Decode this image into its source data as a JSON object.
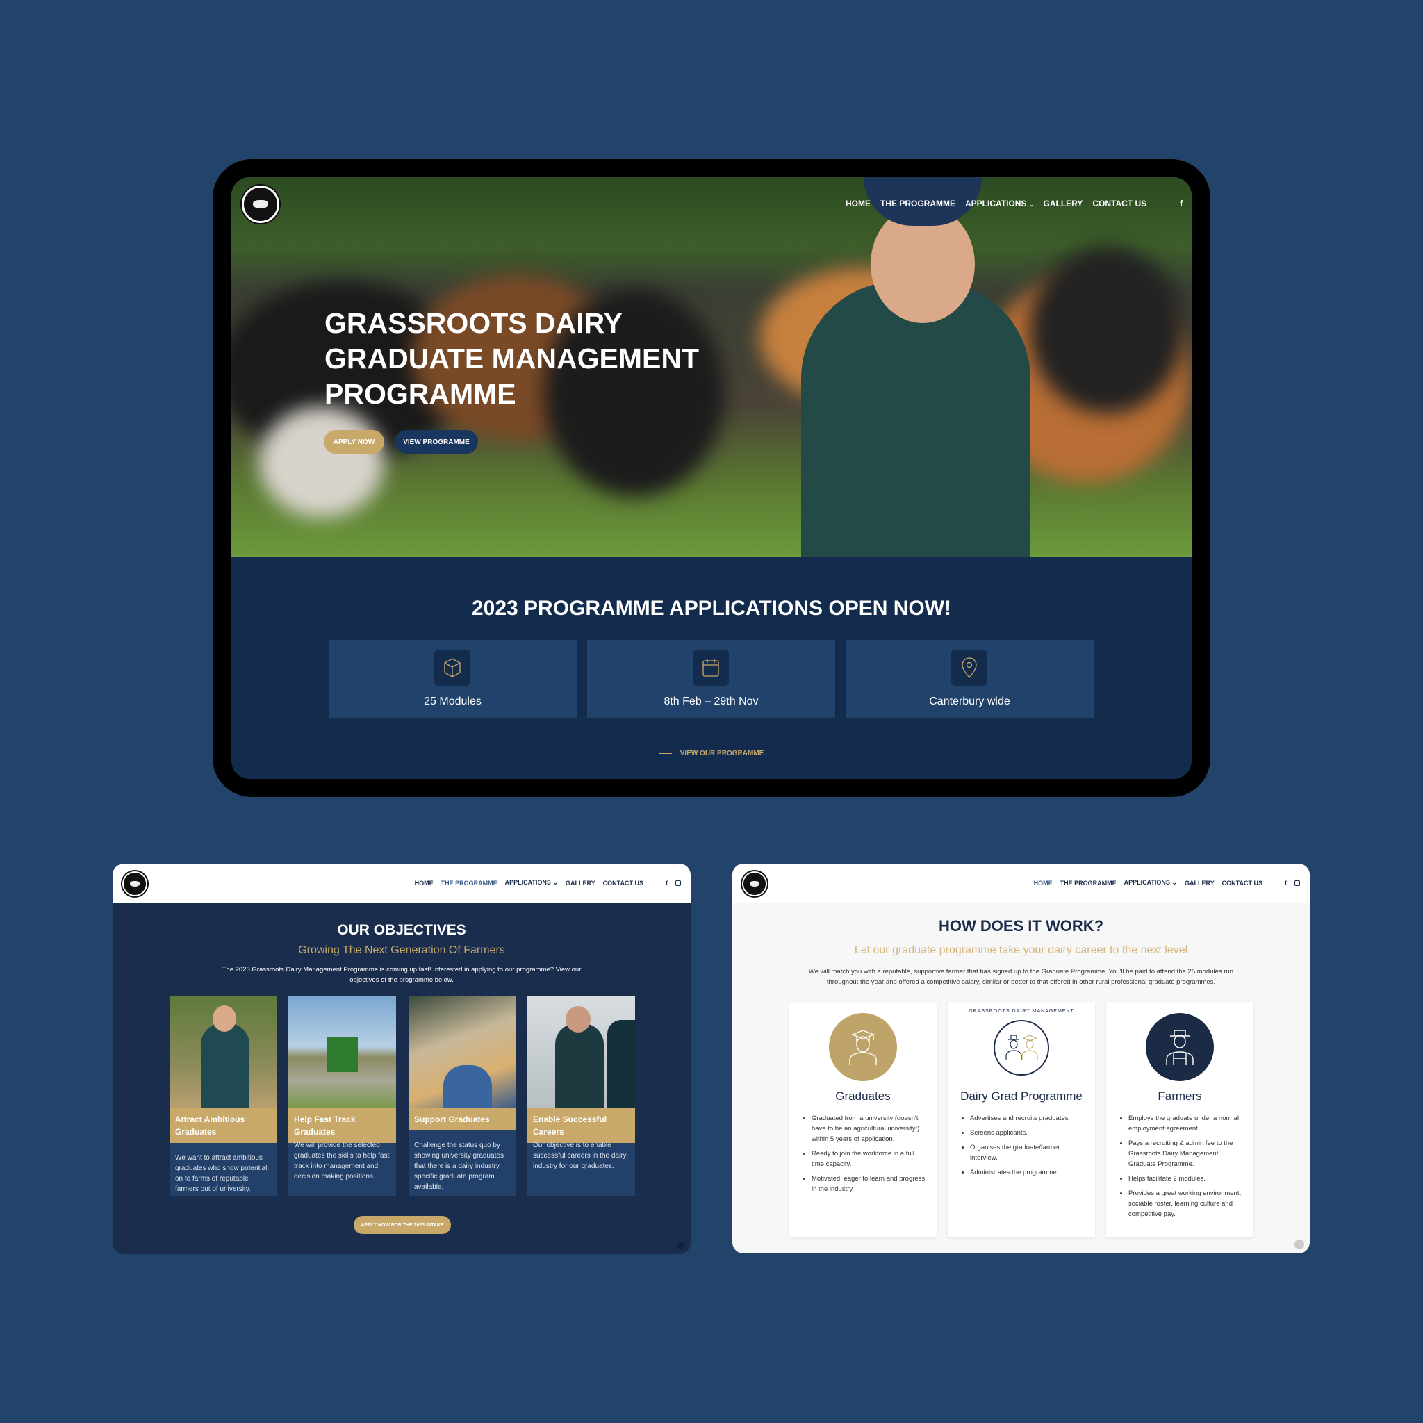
{
  "colors": {
    "background": "#22446b",
    "navy": "#132c4d",
    "card_blue": "#21426b",
    "gold": "#c9a96a"
  },
  "brand": {
    "logo_text": "GRASSROOTS DAIRY MANAGEMENT"
  },
  "hero_page": {
    "nav": [
      {
        "label": "HOME"
      },
      {
        "label": "THE PROGRAMME"
      },
      {
        "label": "APPLICATIONS",
        "has_dropdown": true
      },
      {
        "label": "GALLERY"
      },
      {
        "label": "CONTACT US"
      }
    ],
    "social": [
      {
        "icon": "facebook-icon",
        "glyph": "f"
      },
      {
        "icon": "instagram-icon"
      }
    ],
    "title_lines": [
      "GRASSROOTS DAIRY",
      "GRADUATE MANAGEMENT",
      "PROGRAMME"
    ],
    "apply_button": "APPLY NOW",
    "view_button": "VIEW PROGRAMME",
    "section_heading": "2023 PROGRAMME APPLICATIONS OPEN NOW!",
    "stats": [
      {
        "icon": "cube-icon",
        "label": "25 Modules"
      },
      {
        "icon": "calendar-icon",
        "label": "8th Feb – 29th Nov"
      },
      {
        "icon": "location-pin-icon",
        "label": "Canterbury wide"
      }
    ],
    "view_link": "VIEW OUR PROGRAMME"
  },
  "objectives_page": {
    "nav": [
      {
        "label": "HOME"
      },
      {
        "label": "THE PROGRAMME",
        "active": true
      },
      {
        "label": "APPLICATIONS",
        "has_dropdown": true
      },
      {
        "label": "GALLERY"
      },
      {
        "label": "CONTACT US"
      }
    ],
    "title": "OUR OBJECTIVES",
    "subtitle": "Growing The Next Generation Of Farmers",
    "description": "The 2023 Grassroots Dairy Management Programme is coming up fast! Interested in applying to our programme? View our objectives of the programme below.",
    "cards": [
      {
        "title": "Attract Ambitious Graduates",
        "text": "We want to attract ambitious graduates who show potential, on to farms of reputable farmers out of university."
      },
      {
        "title": "Help Fast Track Graduates",
        "text": "We will provide the selected graduates the skills to help fast track into management and decision making positions."
      },
      {
        "title": "Support Graduates",
        "text": "Challenge the status quo by showing university graduates that there is a dairy industry specific graduate program available."
      },
      {
        "title": "Enable Successful Careers",
        "text": "Our objective is to enable successful careers in the dairy industry for our graduates."
      }
    ],
    "cta": "APPLY NOW FOR THE 2023 INTAKE"
  },
  "how_page": {
    "nav": [
      {
        "label": "HOME",
        "active": true
      },
      {
        "label": "THE PROGRAMME"
      },
      {
        "label": "APPLICATIONS",
        "has_dropdown": true
      },
      {
        "label": "GALLERY"
      },
      {
        "label": "CONTACT US"
      }
    ],
    "title": "HOW DOES IT WORK?",
    "subtitle": "Let our graduate programme take your dairy career to the next level",
    "description": "We will match you with a reputable, supportive farmer that has signed up to the Graduate Programme. You'll be paid to attend the 25 modules run throughout the year and offered a competitive salary, similar or better to that offered in other rural professional graduate programmes.",
    "cards": [
      {
        "title": "Graduates",
        "icon": "graduate-icon",
        "items": [
          "Graduated from a university  (doesn't have to be an agricultural university!) within 5 years of application.",
          "Ready to join the workforce in a full time capacity.",
          "Motivated, eager to learn and progress in the industry."
        ]
      },
      {
        "title": "Dairy Grad Programme",
        "icon": "programme-logo-icon",
        "ring_text": "GRASSROOTS DAIRY MANAGEMENT",
        "items": [
          "Advertises and recruits graduates.",
          "Screens applicants.",
          "Organises the graduate/farmer interview.",
          "Administrates the programme."
        ]
      },
      {
        "title": "Farmers",
        "icon": "farmer-icon",
        "items": [
          "Employs the graduate under a normal employment agreement.",
          "Pays a recruiting & admin fee to the Grassroots Dairy Management Graduate Programme.",
          "Helps facilitate 2 modules.",
          "Provides a great working environment, sociable roster, learning culture and competitive pay."
        ]
      }
    ]
  }
}
